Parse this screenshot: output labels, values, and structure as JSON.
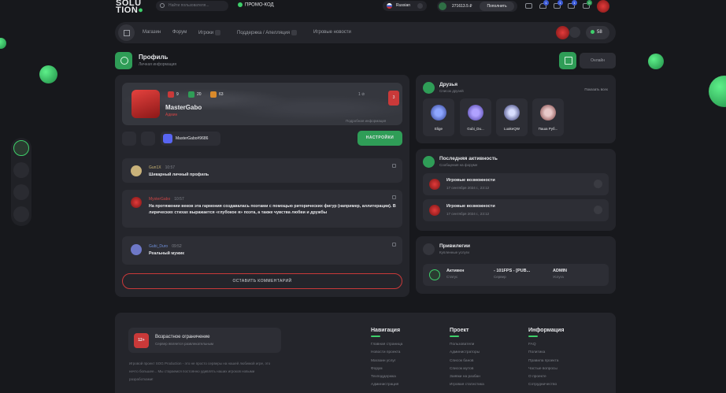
{
  "header": {
    "logo_part1": "SOLU",
    "logo_part2": "TION",
    "search_placeholder": "Найти пользователя...",
    "promo": "ПРОМО-КОД",
    "language": "Russian",
    "balance": "271613.5 ₽",
    "topup": "Пополнить",
    "badges": [
      "1",
      "1",
      "1",
      "0"
    ]
  },
  "nav": {
    "items": [
      "Магазин",
      "Форум",
      "Игроки",
      "Поддержка / Апелляция",
      "Игровые новости"
    ],
    "online_count": "58"
  },
  "page": {
    "title": "Профиль",
    "subtitle": "Личная информация",
    "status": "Онлайн"
  },
  "profile": {
    "name": "MasterGabo",
    "role": "Админ",
    "stats": [
      "9",
      "20",
      "63"
    ],
    "links_count": "1",
    "rank": "3",
    "info_link": "Подробная информация",
    "discord": "MasterGabo#9686",
    "settings": "НАСТРОЙКИ",
    "comments": [
      {
        "author": "Gun1X",
        "date": "10:57",
        "text": "Шикарный личный профиль"
      },
      {
        "author": "MysterGabo",
        "date": "10:57",
        "text": "На протяжении веков эта гармония создавалась поэтами с помощью риторических фигур (например, аллитерации). В лирических стихах выражается «глубокое я» поэта, а также чувства любви и дружбы"
      },
      {
        "author": "Gubi_Duro",
        "date": "09:52",
        "text": "Реальный мужик"
      }
    ],
    "leave_comment": "ОСТАВИТЬ КОММЕНТАРИЙ"
  },
  "friends": {
    "title": "Друзья",
    "subtitle": "Список друзей",
    "show_all": "Показать всех",
    "list": [
      "Elige",
      "Gubi_Du...",
      "LuakeQW",
      "Паша Руб..."
    ]
  },
  "activity": {
    "title": "Последняя активность",
    "subtitle": "Сообщения на форуме",
    "items": [
      {
        "title": "Игровые возможности",
        "date": "17 сентября 2024 г., 23:12"
      },
      {
        "title": "Игровые возможности",
        "date": "17 сентября 2024 г., 23:12"
      }
    ]
  },
  "privileges": {
    "title": "Привилегии",
    "subtitle": "Купленные услуги",
    "cols": [
      {
        "value": "Активен",
        "label": "Статус"
      },
      {
        "value": "- 101FPS - [PUB...",
        "label": "Сервер"
      },
      {
        "value": "ADMIN",
        "label": "Услуга"
      }
    ]
  },
  "footer": {
    "age_badge": "12+",
    "age_title": "Возрастное ограничение",
    "age_sub": "Сервер является развлекательным",
    "description": "Игровой проект SOG Production - это не просто серверы на нашей любимой игре, это нечто большее... Мы стараемся постоянно удивлять наших игроков новыми разработками!",
    "columns": [
      {
        "title": "Навигация",
        "items": [
          "Главная страница",
          "Новости проекта",
          "Магазин услуг",
          "Форум",
          "Техподдержка",
          "Администрация"
        ]
      },
      {
        "title": "Проект",
        "items": [
          "Пользователи",
          "Администраторы",
          "Список банов",
          "Список мутов",
          "Заявки на разбан",
          "Игровая статистика"
        ]
      },
      {
        "title": "Информация",
        "items": [
          "FAQ",
          "Политика",
          "Правила проекта",
          "Частые вопросы",
          "О проекте",
          "Сотрудничество"
        ]
      }
    ]
  }
}
